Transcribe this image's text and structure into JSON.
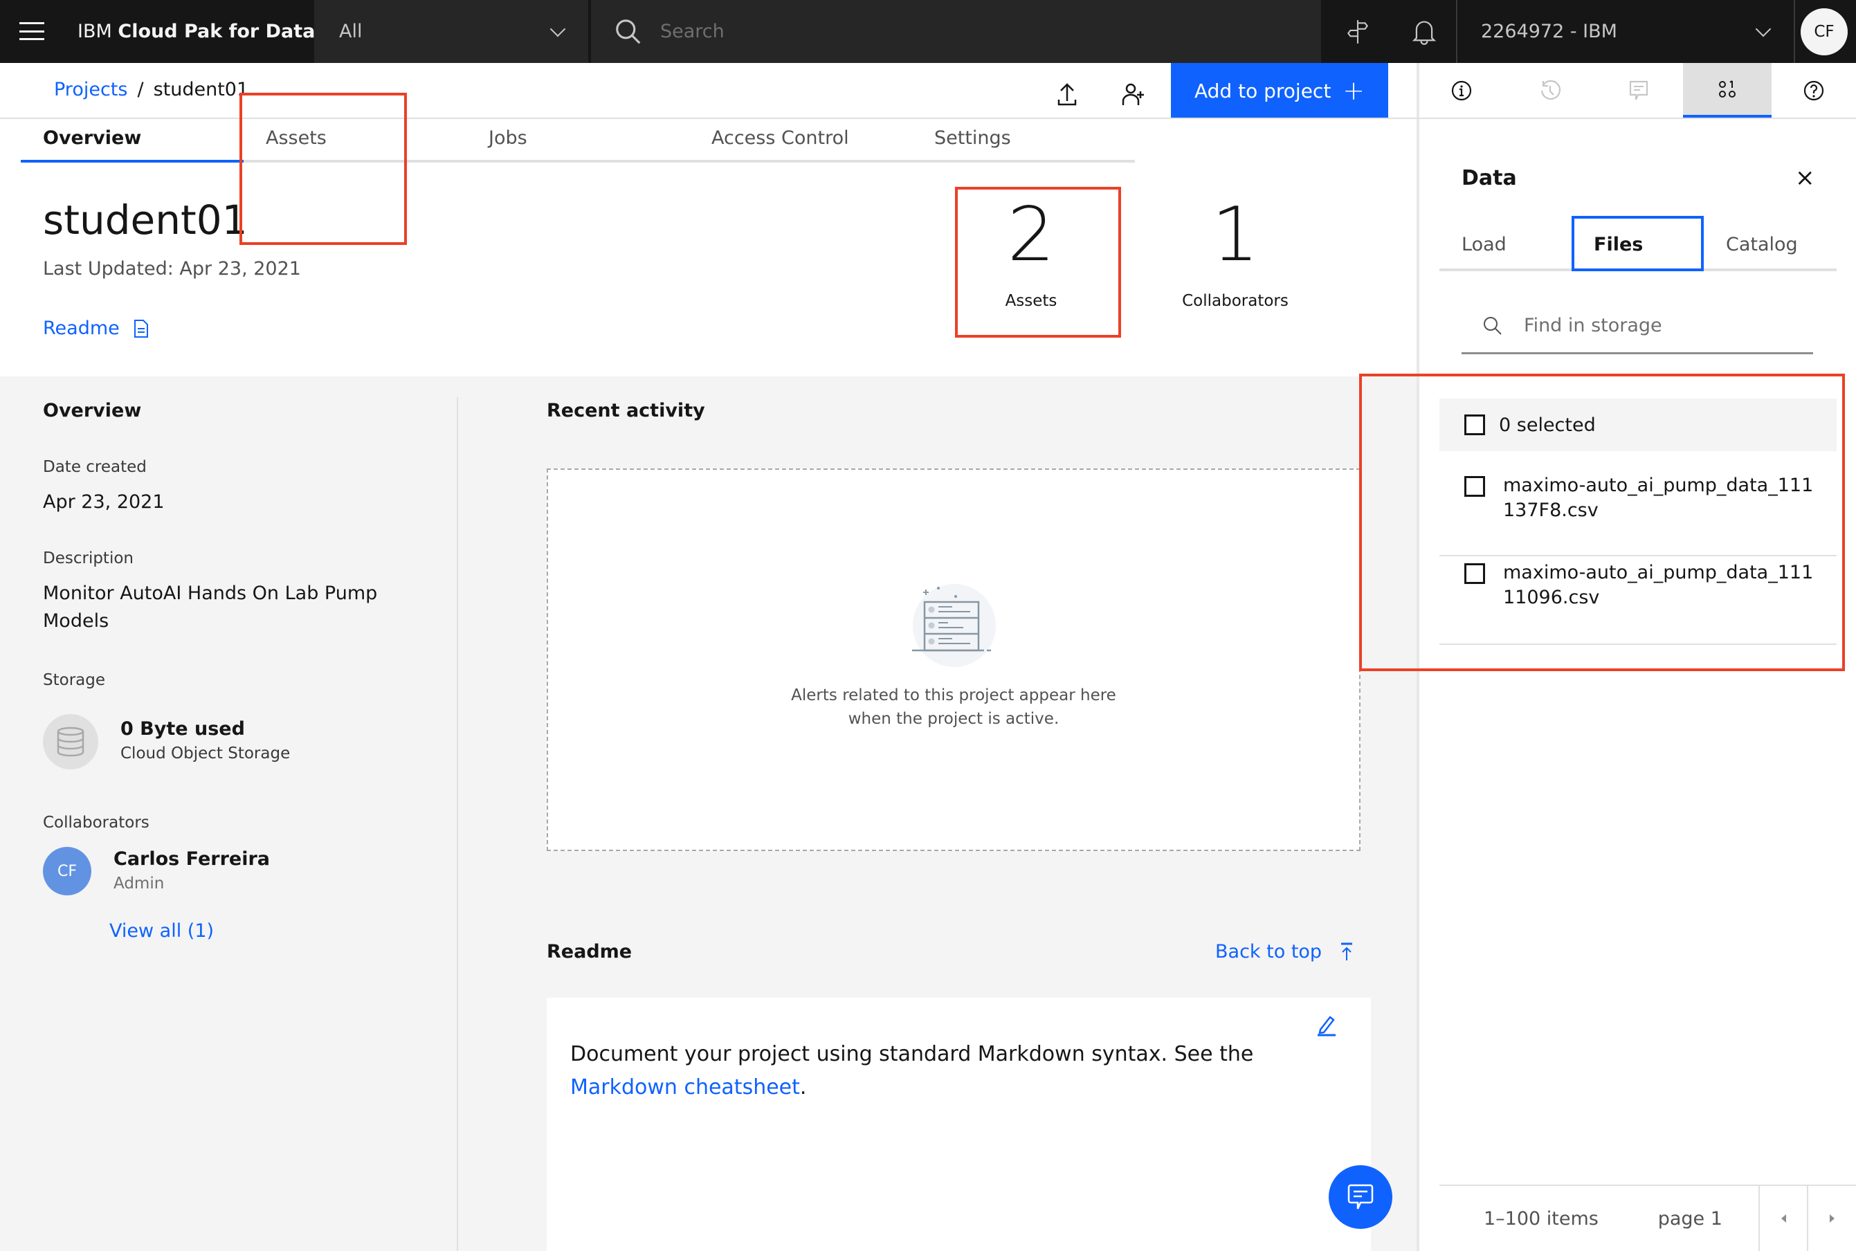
{
  "topbar": {
    "brand_prefix": "IBM",
    "brand_name": "Cloud Pak for Data",
    "scope_value": "All",
    "search_placeholder": "Search",
    "account": "2264972 - IBM",
    "user_initials": "CF"
  },
  "header": {
    "breadcrumb_root": "Projects",
    "breadcrumb_sep": "/",
    "breadcrumb_current": "student01",
    "add_to_project_label": "Add to project",
    "add_icon": "+"
  },
  "tabs": [
    {
      "label": "Overview",
      "active": true
    },
    {
      "label": "Assets",
      "active": false
    },
    {
      "label": "Jobs",
      "active": false
    },
    {
      "label": "Access Control",
      "active": false
    },
    {
      "label": "Settings",
      "active": false
    }
  ],
  "project": {
    "title": "student01",
    "last_updated": "Last Updated: Apr 23, 2021",
    "readme_link": "Readme"
  },
  "stats": [
    {
      "value": "2",
      "label": "Assets"
    },
    {
      "value": "1",
      "label": "Collaborators"
    }
  ],
  "overview": {
    "heading": "Overview",
    "date_created_label": "Date created",
    "date_created": "Apr 23, 2021",
    "description_label": "Description",
    "description": "Monitor AutoAI Hands On Lab Pump Models",
    "storage_label": "Storage",
    "storage_used": "0 Byte used",
    "storage_type": "Cloud Object Storage",
    "collaborators_label": "Collaborators",
    "collaborator_initials": "CF",
    "collaborator_name": "Carlos Ferreira",
    "collaborator_role": "Admin",
    "view_all": "View all (1)"
  },
  "recent_activity": {
    "heading": "Recent activity",
    "empty_line1": "Alerts related to this project appear here",
    "empty_line2": "when the project is active."
  },
  "readme": {
    "heading": "Readme",
    "back_to_top": "Back to top",
    "body_text": "Document your project using standard Markdown syntax. See the",
    "cheatsheet_link": "Markdown cheatsheet",
    "period": "."
  },
  "data_panel": {
    "title": "Data",
    "close_icon": "×",
    "tabs": [
      {
        "label": "Load",
        "active": false
      },
      {
        "label": "Files",
        "active": true
      },
      {
        "label": "Catalog",
        "active": false
      }
    ],
    "search_placeholder": "Find in storage",
    "selected_count": "0 selected",
    "files": [
      {
        "name": "maximo-auto_ai_pump_data_111137F8.csv",
        "checked": false
      },
      {
        "name": "maximo-auto_ai_pump_data_11111096.csv",
        "checked": false
      }
    ],
    "pagination": {
      "items_range": "1–100 items",
      "page": "page 1"
    }
  },
  "colors": {
    "accent": "#0f62fe",
    "topbar_bg": "#161616",
    "annotation_red": "#ea4127",
    "avatar_blue": "#6293e3"
  }
}
